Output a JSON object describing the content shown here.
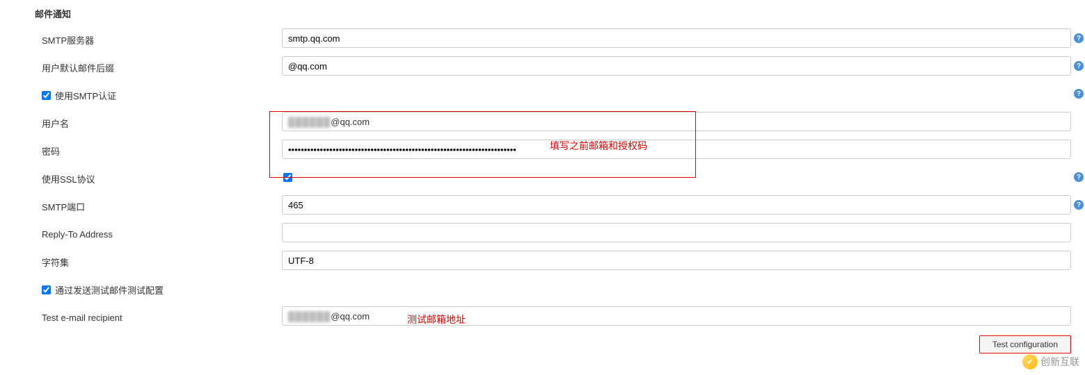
{
  "section_title": "邮件通知",
  "fields": {
    "smtp_server": {
      "label": "SMTP服务器",
      "value": "smtp.qq.com"
    },
    "user_suffix": {
      "label": "用户默认邮件后缀",
      "value": "@qq.com"
    },
    "use_smtp_auth": {
      "label": "使用SMTP认证"
    },
    "username": {
      "label": "用户名",
      "value_visible_suffix": "@qq.com"
    },
    "password": {
      "label": "密码"
    },
    "use_ssl": {
      "label": "使用SSL协议"
    },
    "smtp_port": {
      "label": "SMTP端口",
      "value": "465"
    },
    "reply_to": {
      "label": "Reply-To Address",
      "value": ""
    },
    "charset": {
      "label": "字符集",
      "value": "UTF-8"
    },
    "send_test": {
      "label": "通过发送测试邮件测试配置"
    },
    "test_recipient": {
      "label": "Test e-mail recipient",
      "value_visible_suffix": "@qq.com"
    }
  },
  "annotations": {
    "fill_email_auth": "填写之前邮箱和授权码",
    "test_email_addr": "测试邮箱地址"
  },
  "buttons": {
    "test_configuration": "Test configuration"
  },
  "help_glyph": "?",
  "watermark": "创新互联"
}
